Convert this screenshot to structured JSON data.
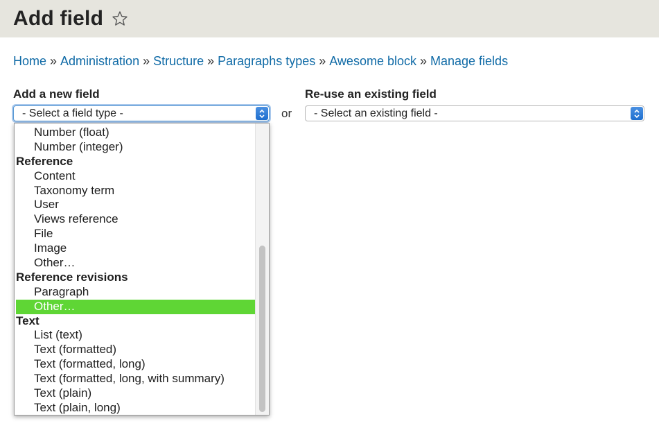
{
  "header": {
    "title": "Add field",
    "star_icon": "star-outline-icon"
  },
  "breadcrumb": [
    "Home",
    "Administration",
    "Structure",
    "Paragraphs types",
    "Awesome block",
    "Manage fields"
  ],
  "breadcrumb_separator": "»",
  "new_field": {
    "label": "Add a new field",
    "select_value": "- Select a field type -"
  },
  "or_text": "or",
  "existing_field": {
    "label": "Re-use an existing field",
    "select_value": "- Select an existing field -"
  },
  "dropdown": {
    "items": [
      {
        "type": "option",
        "label": "Number (float)"
      },
      {
        "type": "option",
        "label": "Number (integer)"
      },
      {
        "type": "group",
        "label": "Reference"
      },
      {
        "type": "option",
        "label": "Content"
      },
      {
        "type": "option",
        "label": "Taxonomy term"
      },
      {
        "type": "option",
        "label": "User"
      },
      {
        "type": "option",
        "label": "Views reference"
      },
      {
        "type": "option",
        "label": "File"
      },
      {
        "type": "option",
        "label": "Image"
      },
      {
        "type": "option",
        "label": "Other…"
      },
      {
        "type": "group",
        "label": "Reference revisions"
      },
      {
        "type": "option",
        "label": "Paragraph"
      },
      {
        "type": "option",
        "label": "Other…",
        "selected": true
      },
      {
        "type": "group",
        "label": "Text"
      },
      {
        "type": "option",
        "label": "List (text)"
      },
      {
        "type": "option",
        "label": "Text (formatted)"
      },
      {
        "type": "option",
        "label": "Text (formatted, long)"
      },
      {
        "type": "option",
        "label": "Text (formatted, long, with summary)"
      },
      {
        "type": "option",
        "label": "Text (plain)"
      },
      {
        "type": "option",
        "label": "Text (plain, long)"
      }
    ]
  },
  "colors": {
    "header_bg": "#e6e5de",
    "link": "#0f6aa6",
    "highlight": "#5fd635",
    "select_arrow": "#1f6fcf"
  }
}
